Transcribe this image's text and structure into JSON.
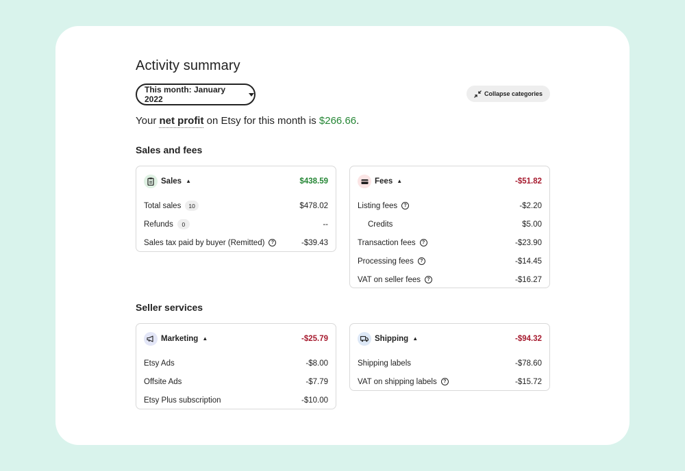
{
  "header": {
    "title": "Activity summary",
    "month_selector": "This month: January 2022",
    "collapse_label": "Collapse categories"
  },
  "profit": {
    "prefix": "Your",
    "term": "net profit",
    "middle": "on Etsy for this month is",
    "amount": "$266.66",
    "suffix": "."
  },
  "sections": {
    "sales_fees": "Sales and fees",
    "seller_services": "Seller services"
  },
  "sales": {
    "name": "Sales",
    "total": "$438.59",
    "rows": [
      {
        "label": "Total sales",
        "badge": "10",
        "value": "$478.02"
      },
      {
        "label": "Refunds",
        "badge": "0",
        "value": "--"
      },
      {
        "label": "Sales tax paid by buyer (Remitted)",
        "value": "-$39.43"
      }
    ]
  },
  "fees": {
    "name": "Fees",
    "total": "-$51.82",
    "rows": [
      {
        "label": "Listing fees",
        "value": "-$2.20"
      },
      {
        "label": "Credits",
        "value": "$5.00"
      },
      {
        "label": "Transaction fees",
        "value": "-$23.90"
      },
      {
        "label": "Processing fees",
        "value": "-$14.45"
      },
      {
        "label": "VAT on seller fees",
        "value": "-$16.27"
      }
    ]
  },
  "marketing": {
    "name": "Marketing",
    "total": "-$25.79",
    "rows": [
      {
        "label": "Etsy Ads",
        "value": "-$8.00"
      },
      {
        "label": "Offsite Ads",
        "value": "-$7.79"
      },
      {
        "label": "Etsy Plus subscription",
        "value": "-$10.00"
      }
    ]
  },
  "shipping": {
    "name": "Shipping",
    "total": "-$94.32",
    "rows": [
      {
        "label": "Shipping labels",
        "value": "-$78.60"
      },
      {
        "label": "VAT on shipping labels",
        "value": "-$15.72"
      }
    ]
  },
  "icons": {
    "help": "?",
    "chevron": "▲",
    "sales": "clipboard-icon",
    "fees": "wallet-icon",
    "marketing": "megaphone-icon",
    "shipping": "delivery-truck-icon"
  },
  "colors": {
    "positive": "#258635",
    "negative": "#a61a2e",
    "background": "#d9f3ec"
  }
}
